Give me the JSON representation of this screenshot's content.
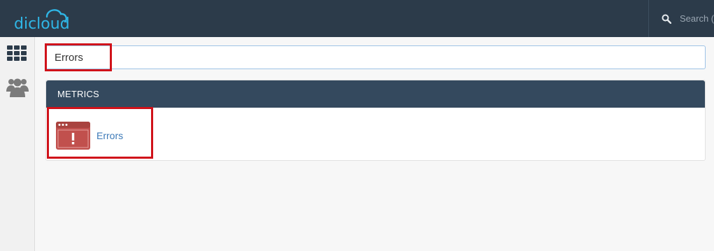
{
  "app": {
    "brand": "dicloud"
  },
  "header": {
    "search_label": "Search ("
  },
  "sidebar": {
    "icons": [
      "grid-apps-icon",
      "users-icon"
    ]
  },
  "search": {
    "value": "Errors"
  },
  "panel": {
    "title": "METRICS",
    "items": [
      {
        "label": "Errors",
        "icon": "error-window-icon"
      }
    ]
  },
  "colors": {
    "topbar": "#2c3b4a",
    "panel_header": "#34495e",
    "logo": "#2fb6e6",
    "link": "#3d7ab8",
    "error_icon": "#c1504d",
    "highlight": "#d0121a"
  }
}
